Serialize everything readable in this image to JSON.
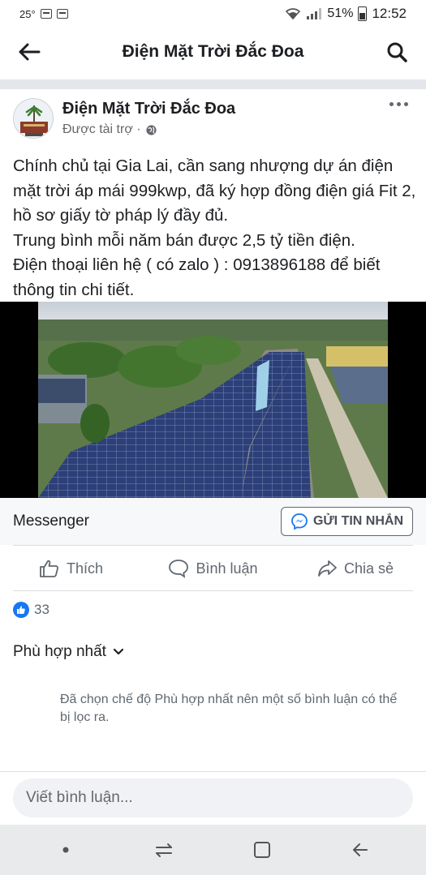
{
  "status_bar": {
    "temperature": "25°",
    "battery_percent": "51%",
    "time": "12:52",
    "icons": [
      "calendar-icon",
      "calendar-icon",
      "wifi-icon",
      "signal-icon",
      "battery-icon"
    ]
  },
  "app_bar": {
    "title": "Điện Mặt Trời Đắc Đoa",
    "back_icon": "arrow-left-icon",
    "search_icon": "search-icon"
  },
  "post": {
    "page_name": "Điện Mặt Trời Đắc Đoa",
    "sponsored_label": "Được tài trợ ·",
    "privacy_icon": "globe-icon",
    "more_icon": "more-horizontal-icon",
    "text": "Chính chủ tại Gia Lai, cần sang nhượng dự án điện mặt trời áp mái 999kwp, đã ký hợp đồng điện giá Fit 2,  hồ sơ giấy tờ pháp lý đầy đủ.\nTrung bình mỗi năm bán được 2,5 tỷ tiền điện.\nĐiện thoại liên hệ ( có zalo ) : 0913896188 để biết thông tin chi tiết."
  },
  "cta": {
    "label": "Messenger",
    "button_label": "GỬI TIN NHẮN",
    "button_icon": "messenger-icon"
  },
  "actions": [
    {
      "label": "Thích",
      "icon": "thumbs-up-icon"
    },
    {
      "label": "Bình luận",
      "icon": "comment-icon"
    },
    {
      "label": "Chia sẻ",
      "icon": "share-icon"
    }
  ],
  "reactions": {
    "count": "33",
    "icon": "like-reaction-icon"
  },
  "comments": {
    "sort_label": "Phù hợp nhất",
    "filter_note": "Đã chọn chế độ Phù hợp nhất nên một số bình luận có thể bị lọc ra.",
    "input_placeholder": "Viết bình luận..."
  },
  "nav_bar": {
    "icons": [
      "dot-icon",
      "recent-apps-icon",
      "home-icon",
      "back-icon"
    ]
  },
  "colors": {
    "accent": "#1877f2",
    "text_primary": "#1c1e21",
    "text_secondary": "#65676b",
    "divider": "#e4e6eb"
  }
}
